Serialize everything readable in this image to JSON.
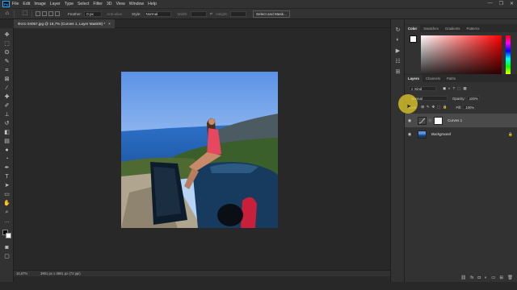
{
  "app": {
    "logo": "Ps"
  },
  "menu": [
    "File",
    "Edit",
    "Image",
    "Layer",
    "Type",
    "Select",
    "Filter",
    "3D",
    "View",
    "Window",
    "Help"
  ],
  "window_controls": [
    "—",
    "❐",
    "✕"
  ],
  "options": {
    "feather_label": "Feather:",
    "feather_value": "0 px",
    "antialias_label": "Anti-alias",
    "style_label": "Style:",
    "style_value": "Normal",
    "width_label": "Width:",
    "height_label": "Height:",
    "select_mask_label": "Select and Mask..."
  },
  "document": {
    "tab_title": "Фото 04057.jpg @ 16,7% (Curves 1, Layer Mask/8) *",
    "close_glyph": "×"
  },
  "status": {
    "zoom": "16,67%",
    "doc_info": "3901 px x 3901 px (72 ppi)"
  },
  "color_panel": {
    "tabs": [
      "Color",
      "Swatches",
      "Gradients",
      "Patterns"
    ],
    "active_tab": "Color",
    "foreground": "#ffffff",
    "background": "#ffffff"
  },
  "layers_panel": {
    "tabs": [
      "Layers",
      "Channels",
      "Paths"
    ],
    "active_tab": "Layers",
    "kind_label": "Kind",
    "blend_mode": "Normal",
    "opacity_label": "Opacity:",
    "opacity_value": "100%",
    "lock_label": "Lock:",
    "fill_label": "Fill:",
    "fill_value": "100%",
    "layers": [
      {
        "name": "Curves 1",
        "selected": true
      },
      {
        "name": "Background",
        "selected": false
      }
    ]
  }
}
